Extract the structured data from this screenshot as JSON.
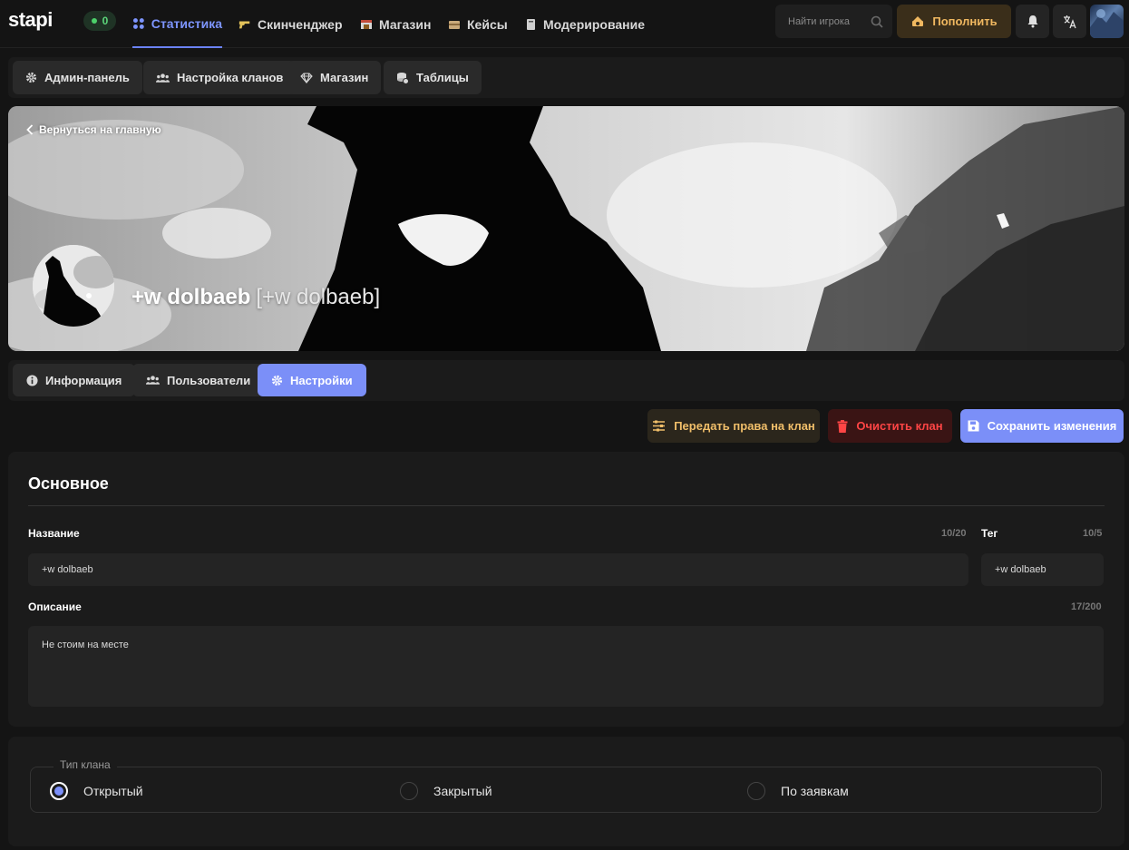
{
  "brand": {
    "logo": "stapi",
    "online_count": "0"
  },
  "nav": [
    {
      "label": "Статистика",
      "icon": "apps-icon",
      "active": true
    },
    {
      "label": "Скинченджер",
      "icon": "pistol-icon"
    },
    {
      "label": "Магазин",
      "icon": "shop-icon"
    },
    {
      "label": "Кейсы",
      "icon": "case-icon"
    },
    {
      "label": "Модерирование",
      "icon": "book-icon"
    }
  ],
  "search": {
    "placeholder": "Найти игрока"
  },
  "topup": {
    "label": "Пополнить"
  },
  "admin_toolbar": [
    {
      "label": "Админ-панель",
      "icon": "gear-icon"
    },
    {
      "label": "Настройка кланов",
      "icon": "users-icon"
    },
    {
      "label": "Магазин",
      "icon": "diamond-icon"
    },
    {
      "label": "Таблицы",
      "icon": "coins-icon"
    }
  ],
  "banner": {
    "back_label": "Вернуться на главную",
    "clan_name": "+w dolbaeb",
    "clan_tag": "[+w dolbaeb]"
  },
  "tabs": [
    {
      "label": "Информация",
      "icon": "info-icon"
    },
    {
      "label": "Пользователи",
      "icon": "users-icon"
    },
    {
      "label": "Настройки",
      "icon": "gear-icon",
      "active": true
    }
  ],
  "actions": {
    "transfer": "Передать права на клан",
    "clear": "Очистить клан",
    "save": "Сохранить изменения"
  },
  "main": {
    "title": "Основное",
    "name": {
      "label": "Название",
      "counter": "10/20",
      "value": "+w dolbaeb"
    },
    "tag": {
      "label": "Тег",
      "counter": "10/5",
      "value": "+w dolbaeb"
    },
    "description": {
      "label": "Описание",
      "counter": "17/200",
      "value": "Не стоим на месте"
    }
  },
  "clan_type": {
    "legend": "Тип клана",
    "options": [
      {
        "label": "Открытый",
        "checked": true
      },
      {
        "label": "Закрытый",
        "checked": false
      },
      {
        "label": "По заявкам",
        "checked": false
      }
    ]
  },
  "colors": {
    "accent": "#7b8ff8",
    "danger": "#ff4545",
    "gold": "#f1bf6a",
    "online": "#4cd06a"
  }
}
